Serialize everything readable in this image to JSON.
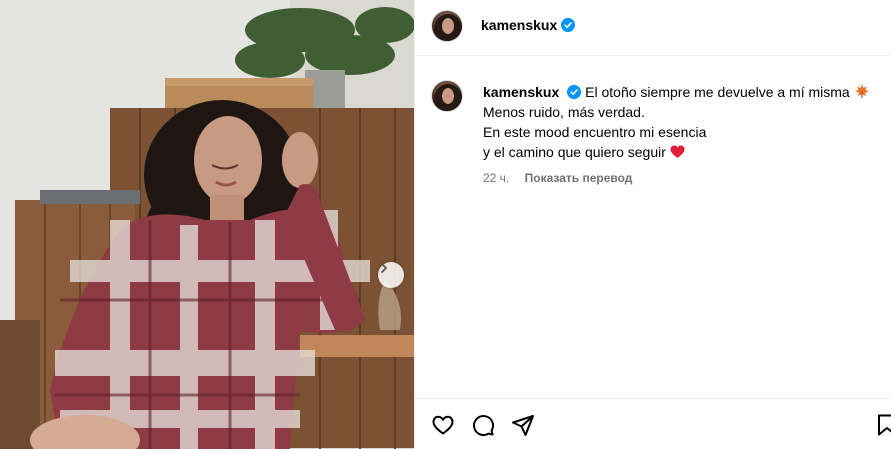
{
  "post": {
    "username": "kamenskux",
    "caption": {
      "line1": "El otoño siempre me devuelve a mí misma",
      "line2": "Menos ruido, más verdad.",
      "line3": "En este mood encuentro mi esencia",
      "line4": "y el camino que quiero seguir"
    },
    "time": "22 ч.",
    "translate_label": "Показать перевод"
  },
  "icons": {
    "verified": "verified-badge-icon",
    "leaf_emoji": "maple-leaf-emoji",
    "heart_emoji": "red-heart-emoji",
    "like": "heart-icon",
    "comment": "comment-icon",
    "share": "paper-plane-icon",
    "save": "bookmark-icon",
    "next": "chevron-right-icon"
  },
  "colors": {
    "verified": "#0095f6",
    "muted_text": "#737373",
    "border": "#efefef"
  }
}
